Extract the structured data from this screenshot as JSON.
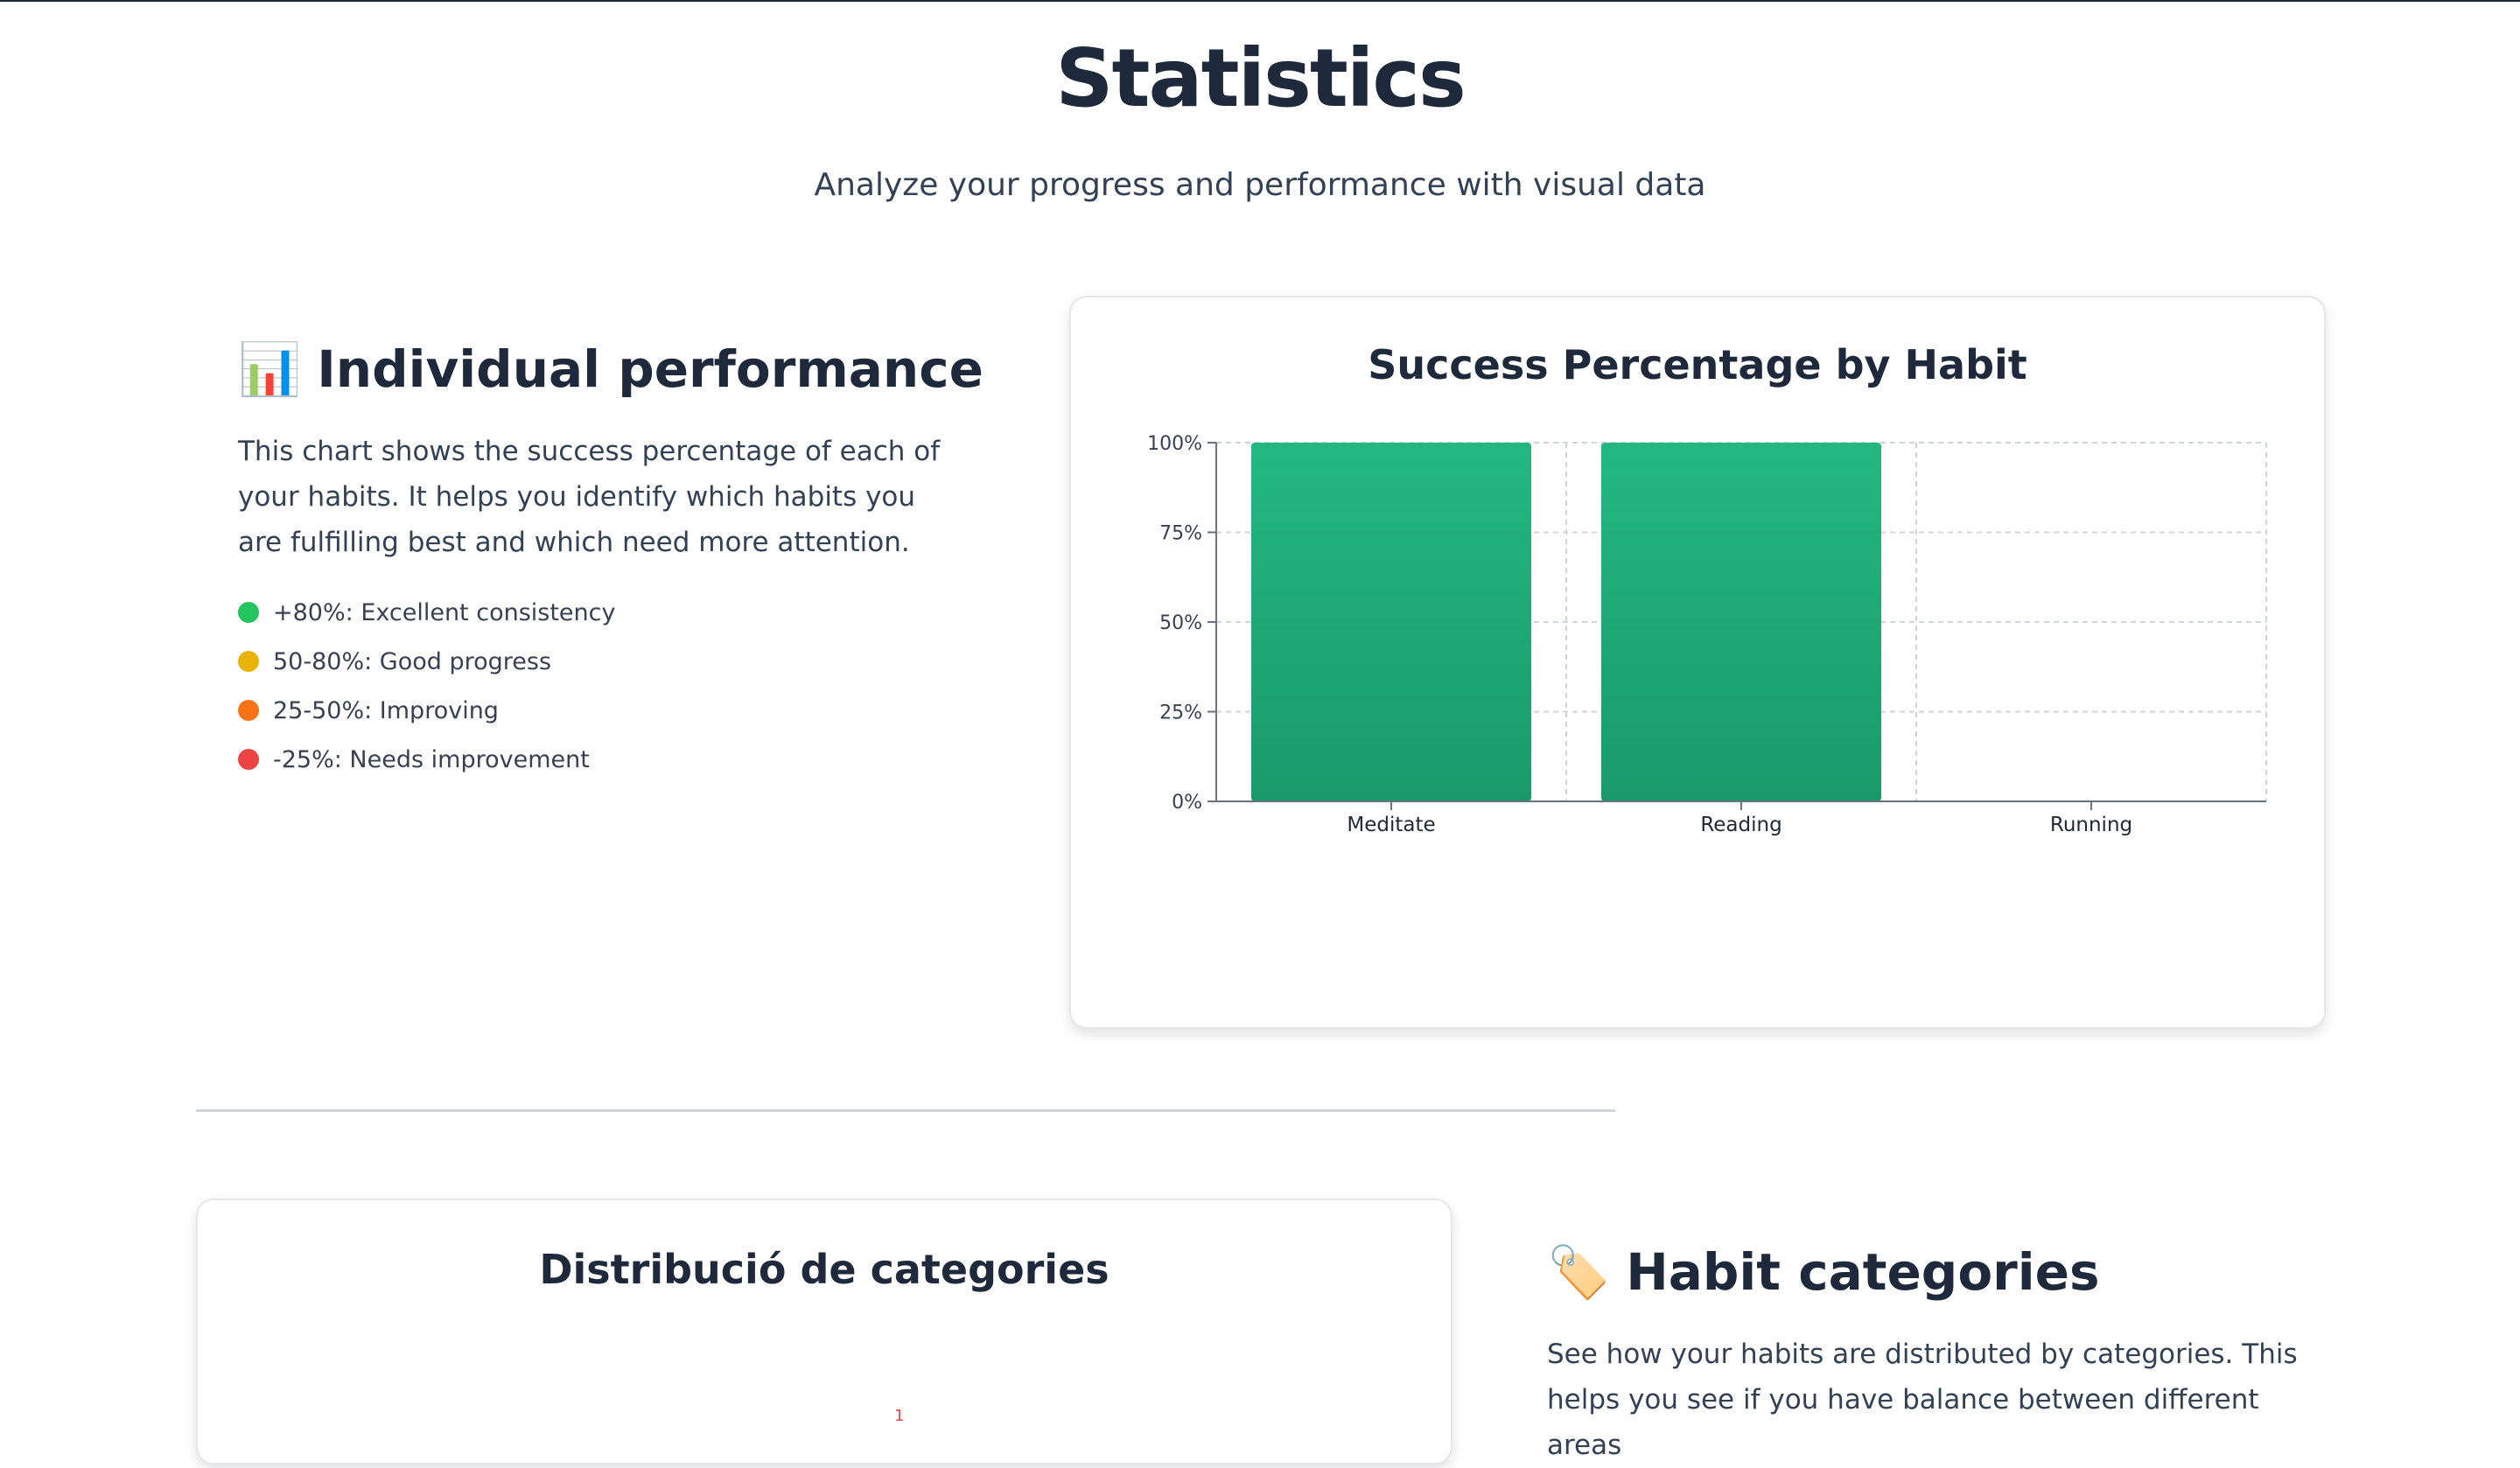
{
  "page": {
    "title": "Statistics",
    "subtitle": "Analyze your progress and performance with visual data"
  },
  "performance": {
    "icon": "bar-chart-icon",
    "icon_glyph": "📊",
    "heading": "Individual performance",
    "description": "This chart shows the success percentage of each of your habits. It helps you identify which habits you are fulfilling best and which need more attention.",
    "legend": [
      {
        "label": "+80%: Excellent consistency",
        "color": "#22c55e"
      },
      {
        "label": "50-80%: Good progress",
        "color": "#eab308"
      },
      {
        "label": "25-50%: Improving",
        "color": "#f97316"
      },
      {
        "label": "-25%: Needs improvement",
        "color": "#ef4444"
      }
    ]
  },
  "chart_data": {
    "type": "bar",
    "title": "Success Percentage by Habit",
    "categories": [
      "Meditate",
      "Reading",
      "Running"
    ],
    "values": [
      100,
      100,
      0
    ],
    "ylim": [
      0,
      100
    ],
    "yticks": [
      "0%",
      "25%",
      "50%",
      "75%",
      "100%"
    ],
    "grid": true,
    "bar_color": "#1fae7a"
  },
  "categories": {
    "card_title": "Distribució de categories",
    "pie_label": "1",
    "icon": "tag-icon",
    "icon_glyph": "🏷️",
    "heading": "Habit categories",
    "description": "See how your habits are distributed by categories. This helps you see if you have balance between different areas"
  }
}
